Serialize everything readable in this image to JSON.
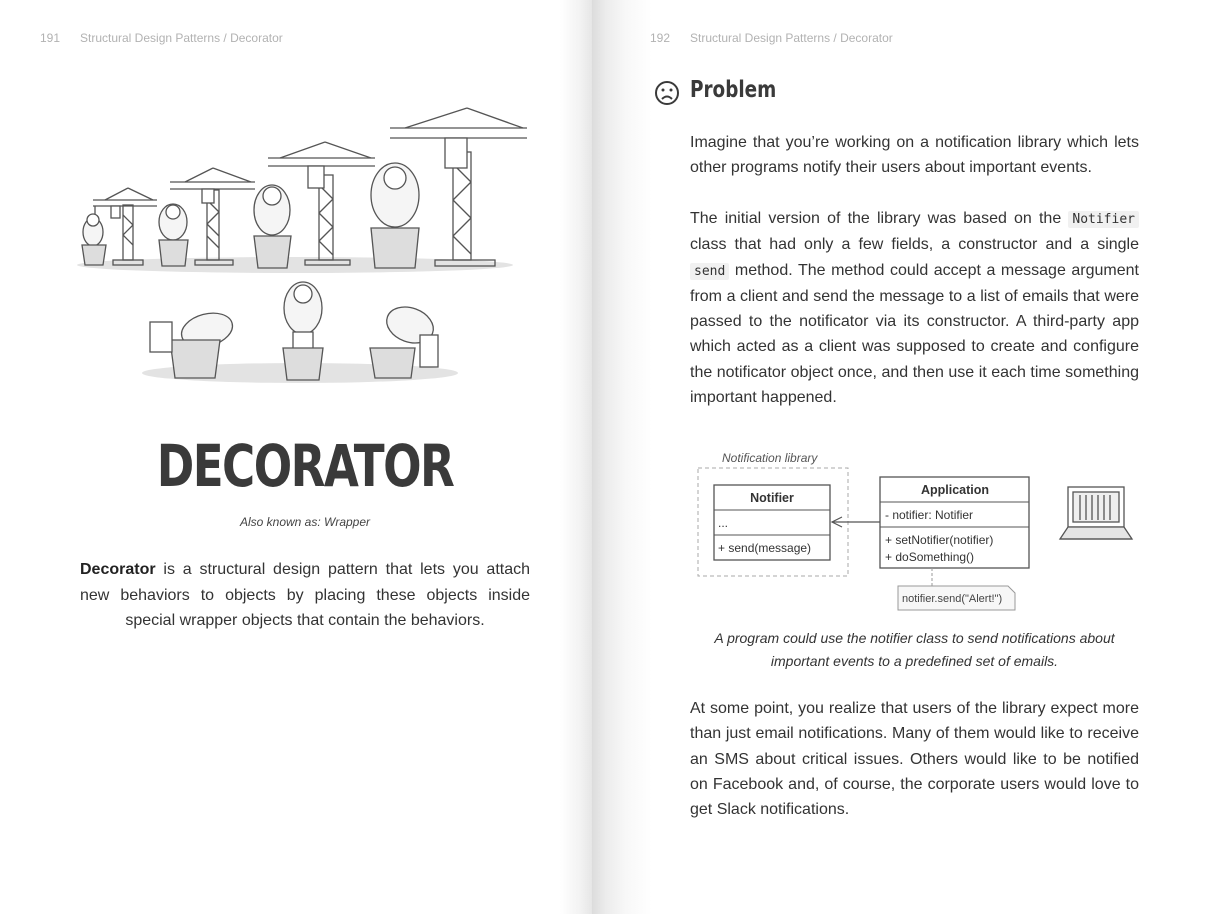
{
  "left_page": {
    "page_number": "191",
    "header": "Structural Design Patterns / Decorator",
    "title": "DECORATOR",
    "aka": "Also known as: Wrapper",
    "intro_bold": "Decorator",
    "intro_rest": " is a structural design pattern that lets you attach new behaviors to objects by placing these objects inside special wrapper objects that contain the behaviors."
  },
  "right_page": {
    "page_number": "192",
    "header": "Structural Design Patterns / Decorator",
    "section_title": "Problem",
    "para1": "Imagine that you’re working on a notification library which lets other programs notify their users about important events.",
    "para2_a": "The initial version of the library was based on the ",
    "para2_code1": "Notifier",
    "para2_b": " class that had only a few fields, a constructor and a single ",
    "para2_code2": "send",
    "para2_c": " method. The method could accept a message argument from a client and send the message to a list of emails that were passed to the notificator via its constructor. A third-party app which acted as a client was supposed to create and configure the notificator object once, and then use it each time something important happened.",
    "diagram": {
      "library_label": "Notification library",
      "notifier_title": "Notifier",
      "notifier_fields": "...",
      "notifier_method": "+ send(message)",
      "app_title": "Application",
      "app_field": "- notifier: Notifier",
      "app_method1": "+ setNotifier(notifier)",
      "app_method2": "+ doSomething()",
      "note": "notifier.send(\"Alert!\")"
    },
    "caption": "A program could use the notifier class to send notifications about important events to a predefined set of emails.",
    "para3": "At some point, you realize that users of the library expect more than just email notifications. Many of them would like to receive an SMS about critical issues. Others would like to be notified on Facebook and, of course, the corporate users would love to get Slack notifications."
  }
}
